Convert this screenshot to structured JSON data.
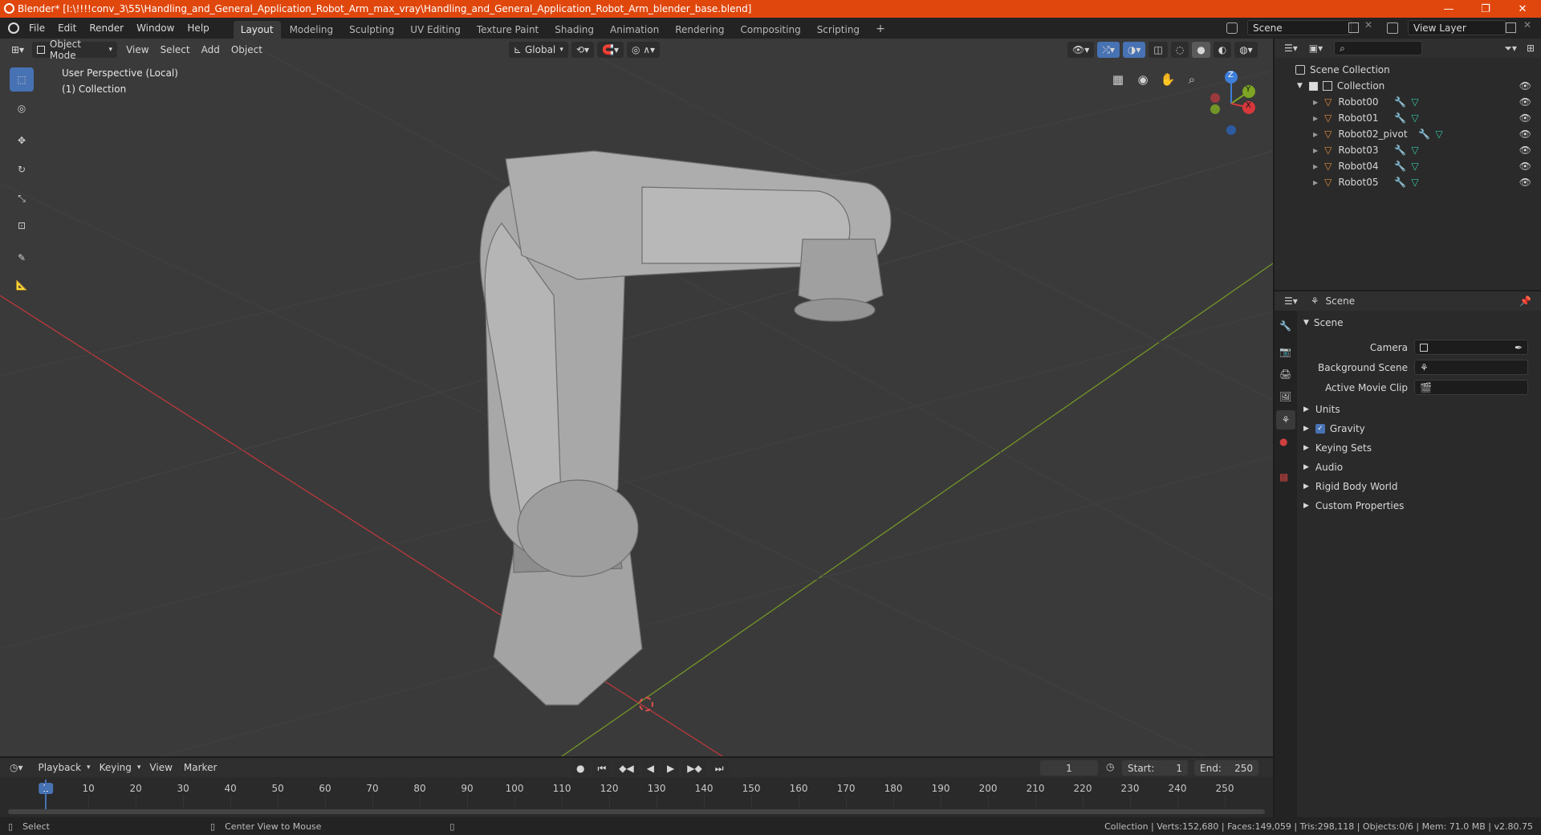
{
  "window": {
    "title": "Blender* [I:\\!!!!conv_3\\55\\Handling_and_General_Application_Robot_Arm_max_vray\\Handling_and_General_Application_Robot_Arm_blender_base.blend]",
    "minimize": "—",
    "restore": "❐",
    "close": "✕"
  },
  "menu": {
    "items": [
      "File",
      "Edit",
      "Render",
      "Window",
      "Help"
    ]
  },
  "workspaces": {
    "tabs": [
      "Layout",
      "Modeling",
      "Sculpting",
      "UV Editing",
      "Texture Paint",
      "Shading",
      "Animation",
      "Rendering",
      "Compositing",
      "Scripting"
    ],
    "active": "Layout",
    "add": "+"
  },
  "scene_selector": {
    "value": "Scene"
  },
  "view_layer_selector": {
    "value": "View Layer"
  },
  "viewport_header": {
    "mode": "Object Mode",
    "menus": [
      "View",
      "Select",
      "Add",
      "Object"
    ],
    "orientation": "Global"
  },
  "viewport": {
    "perspective_label": "User Perspective (Local)",
    "collection_label": "(1) Collection",
    "gizmo_axes": [
      "Z",
      "Y",
      "X"
    ]
  },
  "outliner": {
    "root": "Scene Collection",
    "collection": "Collection",
    "objects": [
      "Robot00",
      "Robot01",
      "Robot02_pivot",
      "Robot03",
      "Robot04",
      "Robot05"
    ]
  },
  "properties": {
    "header_title": "Scene",
    "panel_title": "Scene",
    "fields": [
      {
        "label": "Camera",
        "value": ""
      },
      {
        "label": "Background Scene",
        "value": ""
      },
      {
        "label": "Active Movie Clip",
        "value": ""
      }
    ],
    "sections": [
      "Units",
      "Gravity",
      "Keying Sets",
      "Audio",
      "Rigid Body World",
      "Custom Properties"
    ],
    "gravity_checked": true
  },
  "timeline": {
    "menus": [
      "Playback",
      "Keying",
      "View",
      "Marker"
    ],
    "current_frame": "1",
    "start_label": "Start:",
    "start_value": "1",
    "end_label": "End:",
    "end_value": "250",
    "ticks": [
      "1",
      "10",
      "20",
      "30",
      "40",
      "50",
      "60",
      "70",
      "80",
      "90",
      "100",
      "110",
      "120",
      "130",
      "140",
      "150",
      "160",
      "170",
      "180",
      "190",
      "200",
      "210",
      "220",
      "230",
      "240",
      "250"
    ]
  },
  "statusbar": {
    "select": "Select",
    "center_view": "Center View to Mouse",
    "stats": "Collection | Verts:152,680 | Faces:149,059 | Tris:298,118 | Objects:0/6 | Mem: 71.0 MB | v2.80.75"
  },
  "colors": {
    "titlebar": "#e0470d",
    "accent": "#4772b3",
    "x_axis": "#d6383c",
    "y_axis": "#7ea524",
    "z_axis": "#3d7fd9",
    "object_icon": "#e58a35",
    "modifier_icon": "#5a9ee0",
    "mesh_icon": "#35c7a7"
  }
}
